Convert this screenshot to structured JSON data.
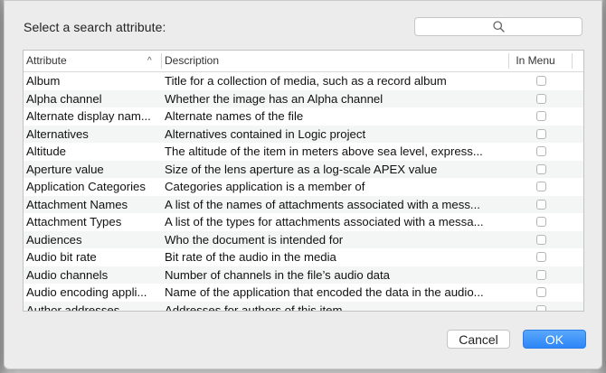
{
  "dialog": {
    "prompt": "Select a search attribute:",
    "search": {
      "placeholder": "",
      "icon": "search-icon"
    },
    "table": {
      "headers": {
        "attribute": "Attribute",
        "description": "Description",
        "in_menu": "In Menu"
      },
      "sort_indicator": "^",
      "rows": [
        {
          "attribute": "Album",
          "description": "Title for a collection of media, such as a record album",
          "in_menu": false
        },
        {
          "attribute": "Alpha channel",
          "description": "Whether the image has an Alpha channel",
          "in_menu": false
        },
        {
          "attribute": "Alternate display nam...",
          "description": "Alternate names of the file",
          "in_menu": false
        },
        {
          "attribute": "Alternatives",
          "description": "Alternatives contained in Logic project",
          "in_menu": false
        },
        {
          "attribute": "Altitude",
          "description": "The altitude of the item in meters above sea level, express...",
          "in_menu": false
        },
        {
          "attribute": "Aperture value",
          "description": "Size of the lens aperture as a log-scale APEX value",
          "in_menu": false
        },
        {
          "attribute": "Application Categories",
          "description": "Categories application is a member of",
          "in_menu": false
        },
        {
          "attribute": "Attachment Names",
          "description": "A list of the names of attachments associated with a mess...",
          "in_menu": false
        },
        {
          "attribute": "Attachment Types",
          "description": "A list of the types for attachments associated with a messa...",
          "in_menu": false
        },
        {
          "attribute": "Audiences",
          "description": "Who the document is intended for",
          "in_menu": false
        },
        {
          "attribute": "Audio bit rate",
          "description": "Bit rate of the audio in the media",
          "in_menu": false
        },
        {
          "attribute": "Audio channels",
          "description": "Number of channels in the file’s audio data",
          "in_menu": false
        },
        {
          "attribute": "Audio encoding appli...",
          "description": "Name of the application that encoded the data in the audio...",
          "in_menu": false
        },
        {
          "attribute": "Author addresses",
          "description": "Addresses for authors of this item",
          "in_menu": false
        }
      ]
    },
    "buttons": {
      "cancel": "Cancel",
      "ok": "OK"
    },
    "colors": {
      "accent": "#2d86f7",
      "row_alt": "#f4f5f5"
    }
  }
}
